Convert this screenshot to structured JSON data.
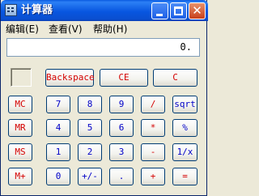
{
  "window": {
    "title": "计算器"
  },
  "menu": [
    {
      "label": "编辑(E)"
    },
    {
      "label": "查看(V)"
    },
    {
      "label": "帮助(H)"
    }
  ],
  "display": {
    "value": "0."
  },
  "buttons": {
    "backspace": "Backspace",
    "ce": "CE",
    "c": "C",
    "mc": "MC",
    "mr": "MR",
    "ms": "MS",
    "mplus": "M+",
    "n7": "7",
    "n8": "8",
    "n9": "9",
    "n4": "4",
    "n5": "5",
    "n6": "6",
    "n1": "1",
    "n2": "2",
    "n3": "3",
    "n0": "0",
    "sign": "+/-",
    "dot": ".",
    "div": "/",
    "mul": "*",
    "sub": "-",
    "add": "+",
    "sqrt": "sqrt",
    "pct": "%",
    "inv": "1/x",
    "eq": "="
  },
  "colors": {
    "titlebar": "#0A5BE0",
    "button_border": "#003C74",
    "red_label": "#D40000",
    "blue_label": "#0000C8"
  }
}
